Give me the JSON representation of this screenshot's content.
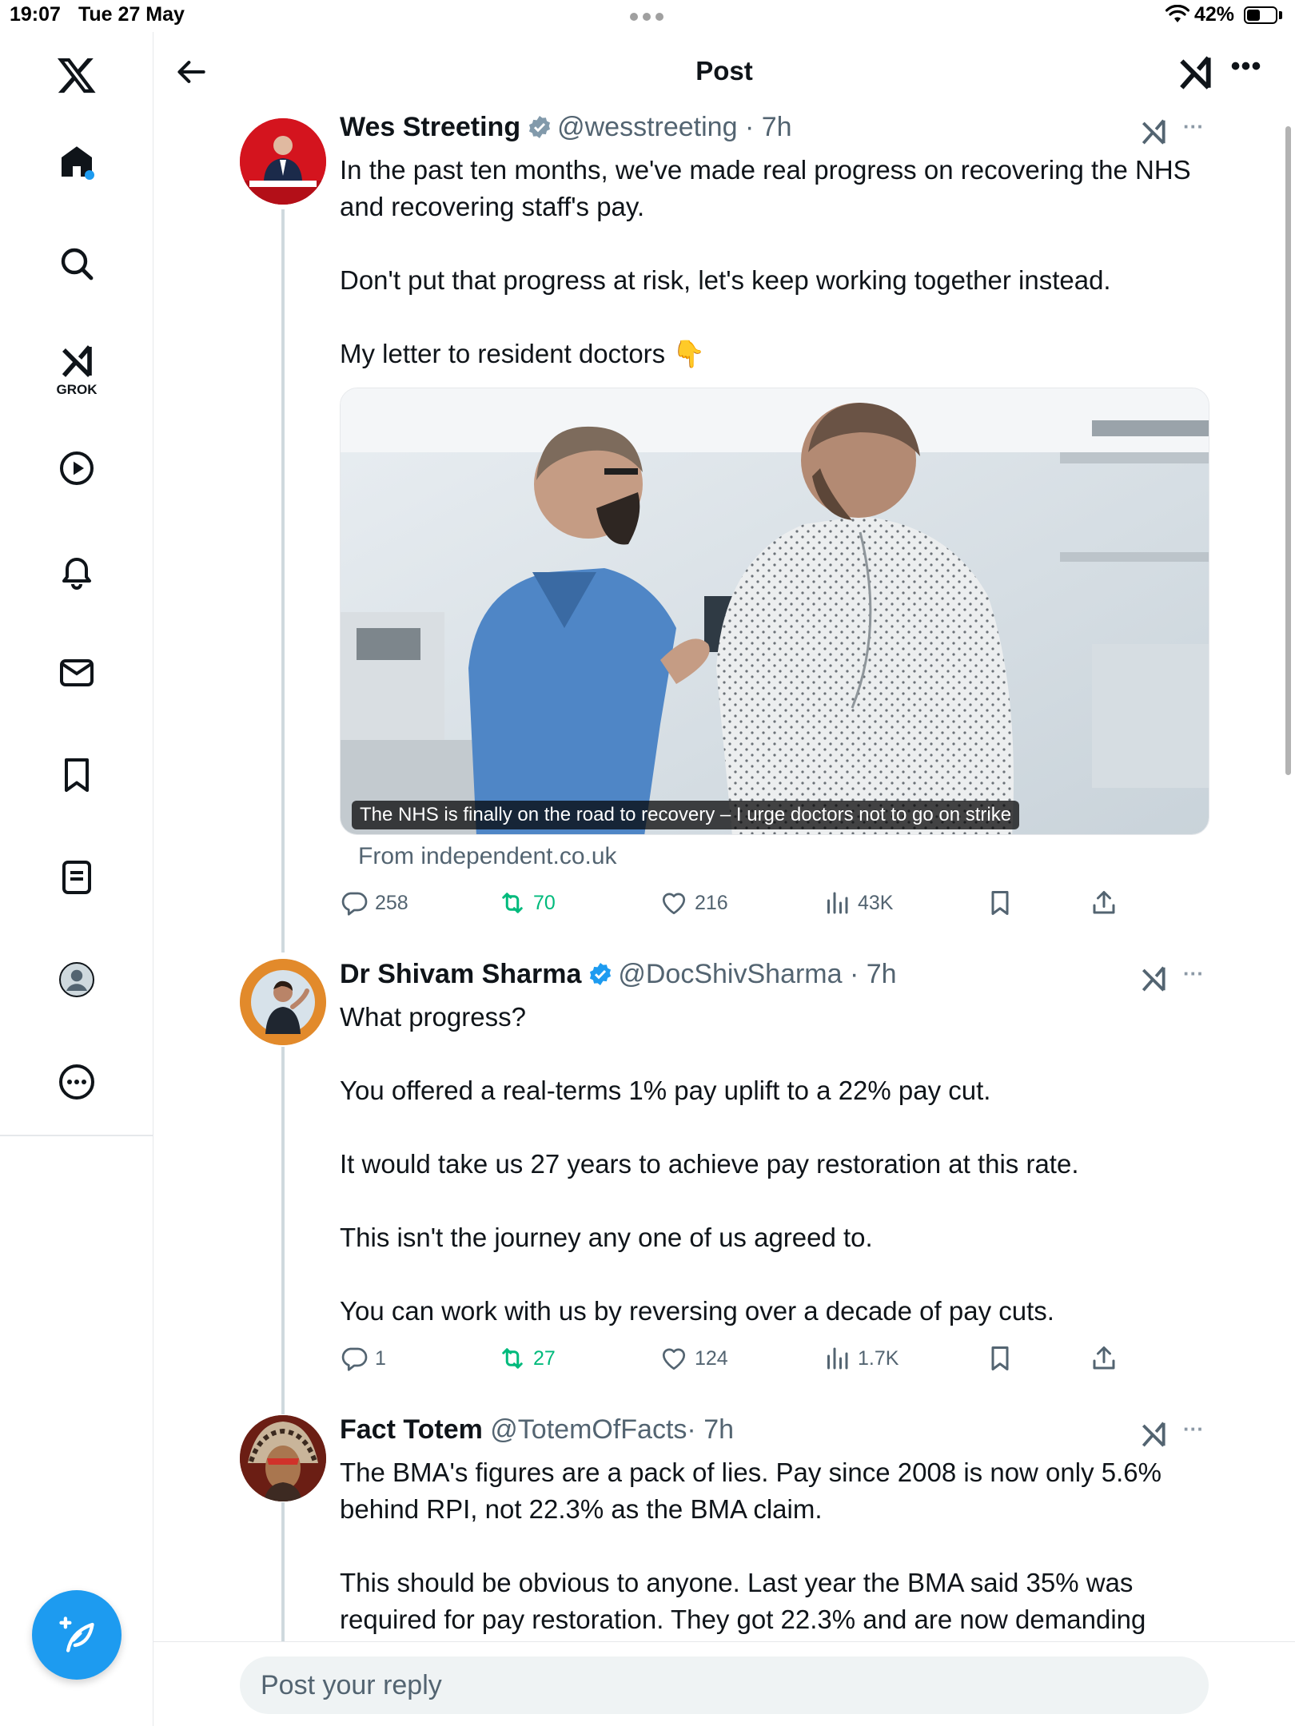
{
  "status_bar": {
    "time": "19:07",
    "date": "Tue 27 May",
    "battery": "42%"
  },
  "sidebar": {
    "items": [
      {
        "name": "x-logo"
      },
      {
        "name": "home-icon",
        "active": true,
        "notification_dot": "#1d9bf0"
      },
      {
        "name": "search-icon"
      },
      {
        "name": "grok-icon",
        "label": "GROK"
      },
      {
        "name": "video-icon"
      },
      {
        "name": "notifications-icon"
      },
      {
        "name": "messages-icon"
      },
      {
        "name": "bookmarks-icon"
      },
      {
        "name": "lists-icon"
      },
      {
        "name": "profile-icon"
      },
      {
        "name": "more-icon"
      }
    ],
    "compose_icon": "compose-icon"
  },
  "header": {
    "title": "Post"
  },
  "posts": [
    {
      "name": "Wes Streeting",
      "verified": true,
      "verified_color": "#829aab",
      "handle": "@wesstreeting",
      "time": "· 7h",
      "text": [
        "In the past ten months, we've made real progress on recovering the NHS and recovering staff's pay.",
        "",
        "Don't put that progress at risk, let's keep working together instead.",
        "",
        "My letter to resident doctors 👇"
      ],
      "card": {
        "caption": "The NHS is finally on the road to recovery – I urge doctors not to go on strike",
        "source": "From independent.co.uk"
      },
      "stats": {
        "replies": "258",
        "reposts": "70",
        "likes": "216",
        "views": "43K"
      }
    },
    {
      "name": "Dr Shivam Sharma",
      "verified": true,
      "verified_color": "#1d9bf0",
      "handle": "@DocShivSharma",
      "time": "· 7h",
      "text": [
        "What progress?",
        "",
        "You offered a real-terms 1% pay uplift to a 22% pay cut.",
        "",
        "It would take us 27 years to achieve pay restoration at this rate.",
        "",
        "This isn't the journey any one of us agreed to.",
        "",
        "You can work with us by reversing over a decade of pay cuts."
      ],
      "stats": {
        "replies": "1",
        "reposts": "27",
        "likes": "124",
        "views": "1.7K"
      }
    },
    {
      "name": "Fact Totem",
      "verified": false,
      "handle": "@TotemOfFacts",
      "time": "· 7h",
      "text": [
        "The BMA's figures are a pack of lies. Pay since 2008 is now only 5.6% behind RPI, not 22.3% as the BMA claim.",
        "",
        "This should be obvious to anyone. Last year the BMA said 35% was required for pay restoration. They got 22.3% and are now demanding"
      ]
    }
  ],
  "reply": {
    "placeholder": "Post your reply"
  },
  "colors": {
    "accent": "#1d9bf0",
    "retweet": "#00ba7c",
    "muted": "#536471",
    "thread_line": "#cfd9de"
  }
}
